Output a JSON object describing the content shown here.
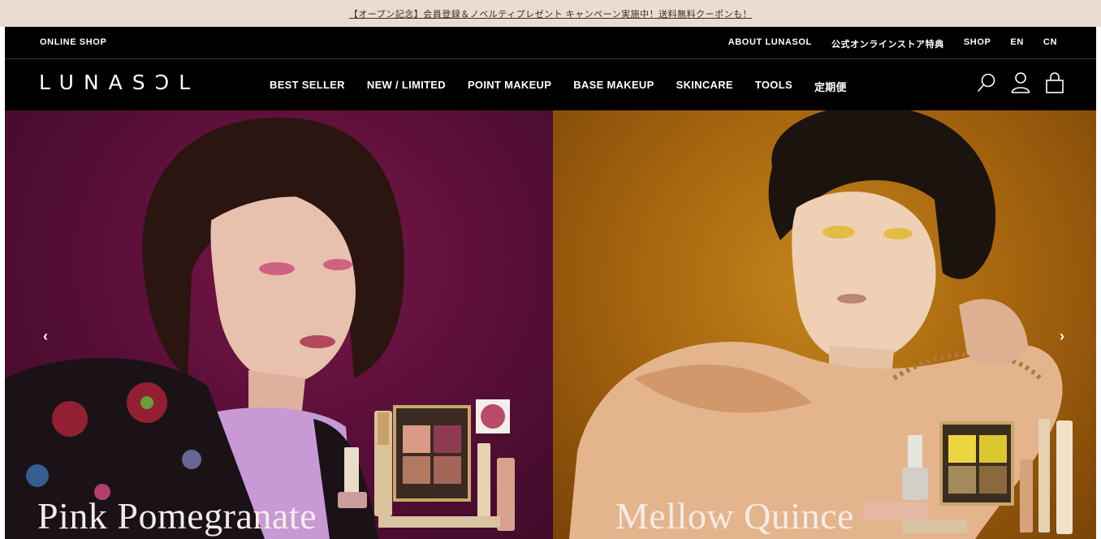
{
  "promo": {
    "text": "【オープン記念】会員登録＆ノベルティプレゼント キャンペーン実施中！送料無料クーポンも！"
  },
  "utility": {
    "online_shop": "ONLINE SHOP",
    "links": [
      "ABOUT LUNASOL",
      "公式オンラインストア特典",
      "SHOP",
      "EN",
      "CN"
    ]
  },
  "brand": {
    "logo": "LUNASƆL"
  },
  "nav": {
    "items": [
      "BEST SELLER",
      "NEW / LIMITED",
      "POINT MAKEUP",
      "BASE MAKEUP",
      "SKINCARE",
      "TOOLS",
      "定期便"
    ]
  },
  "icons": [
    "search-icon",
    "account-icon",
    "cart-icon"
  ],
  "hero": {
    "slides": [
      {
        "title": "Pink Pomegranate",
        "color": "#5a0f38"
      },
      {
        "title": "Mellow Quince",
        "color": "#a9670f"
      }
    ],
    "prev_label": "‹",
    "next_label": "›"
  },
  "colors": {
    "header_bg": "#000000",
    "promo_bg": "#e9ddd3"
  }
}
